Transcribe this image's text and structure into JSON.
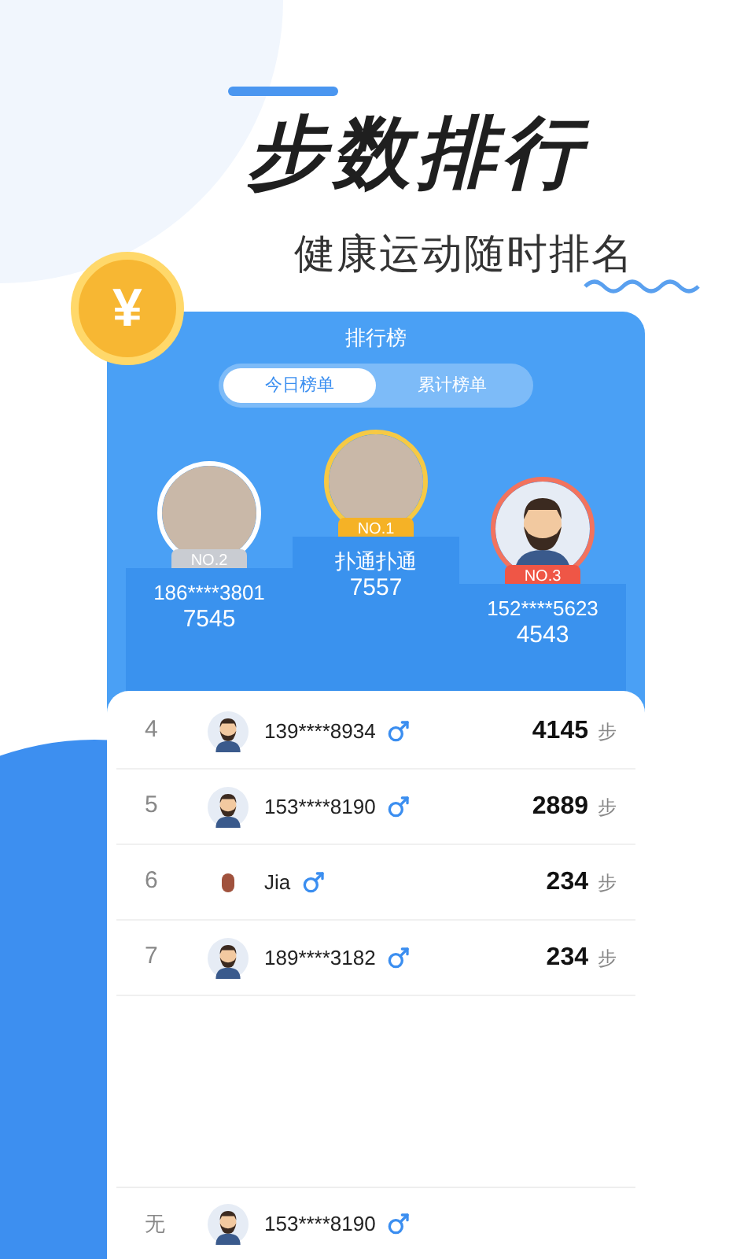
{
  "headline": {
    "title": "步数排行",
    "subtitle": "健康运动随时排名"
  },
  "coin_symbol": "¥",
  "board": {
    "title": "排行榜",
    "tabs": [
      {
        "label": "今日榜单",
        "selected": true
      },
      {
        "label": "累计榜单",
        "selected": false
      }
    ],
    "podium": [
      {
        "kind": "second",
        "badge": "NO.2",
        "name": "186****3801",
        "steps": "7545",
        "avatar": {
          "kind": "photo"
        }
      },
      {
        "kind": "first",
        "badge": "NO.1",
        "name": "扑通扑通",
        "steps": "7557",
        "avatar": {
          "kind": "photo"
        }
      },
      {
        "kind": "third",
        "badge": "NO.3",
        "name": "152****5623",
        "steps": "4543",
        "avatar": {
          "kind": "cartoon"
        }
      }
    ],
    "rows": [
      {
        "rank": "4",
        "avatar": {
          "kind": "cartoon"
        },
        "name": "139****8934",
        "steps": "4145",
        "unit": "步"
      },
      {
        "rank": "5",
        "avatar": {
          "kind": "cartoon"
        },
        "name": "153****8190",
        "steps": "2889",
        "unit": "步"
      },
      {
        "rank": "6",
        "avatar": {
          "kind": "small"
        },
        "name": "Jia",
        "steps": "234",
        "unit": "步"
      },
      {
        "rank": "7",
        "avatar": {
          "kind": "cartoon"
        },
        "name": "189****3182",
        "steps": "234",
        "unit": "步"
      }
    ],
    "my_row": {
      "rank": "无",
      "avatar": {
        "kind": "cartoon"
      },
      "name": "153****8190"
    }
  }
}
